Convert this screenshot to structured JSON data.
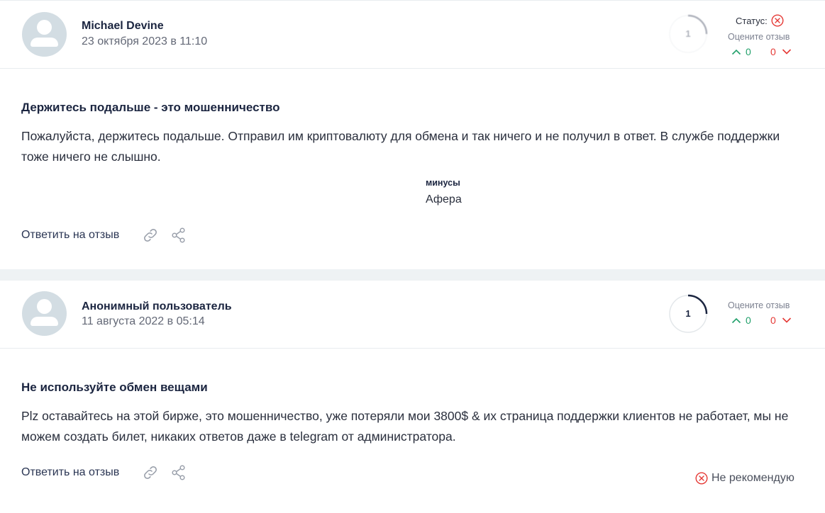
{
  "reviews": [
    {
      "author": "Michael Devine",
      "date": "23 октября 2023 в 11:10",
      "score": "1",
      "status_label": "Статус:",
      "rate_label": "Оцените отзыв",
      "votes_up": "0",
      "votes_down": "0",
      "title": "Держитесь подальше - это мошенничество",
      "text": "Пожалуйста, держитесь подальше. Отправил им криптовалюту для обмена и так ничего и не получил в ответ. В службе поддержки тоже ничего не слышно.",
      "cons_label": "минусы",
      "cons_value": "Афера",
      "reply_label": "Ответить на отзыв"
    },
    {
      "author": "Анонимный пользователь",
      "date": "11 августа 2022 в 05:14",
      "score": "1",
      "rate_label": "Оцените отзыв",
      "votes_up": "0",
      "votes_down": "0",
      "title": "Не используйте обмен вещами",
      "text": "Plz оставайтесь на этой бирже, это мошенничество, уже потеряли мои 3800$ & их страница поддержки клиентов не работает, мы не можем создать билет, никаких ответов даже в telegram от администратора.",
      "reply_label": "Ответить на отзыв",
      "recommendation": "Не рекомендую"
    }
  ],
  "colors": {
    "vote_up": "#22a06b",
    "vote_down": "#e53935",
    "status_negative": "#e53935",
    "separator": "#eef2f4"
  },
  "icons": [
    "user-avatar-icon",
    "status-cross-icon",
    "chevron-up-icon",
    "chevron-down-icon",
    "link-icon",
    "share-icon",
    "not-recommend-cross-icon"
  ]
}
